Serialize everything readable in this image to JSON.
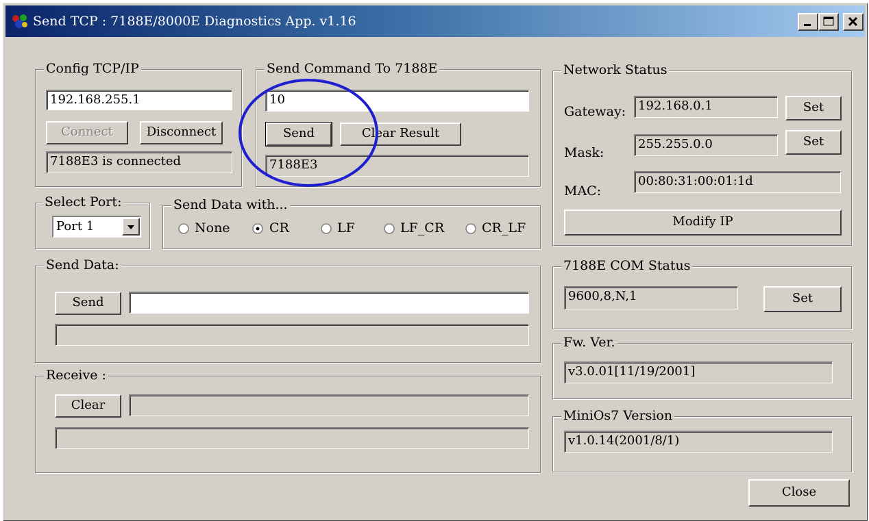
{
  "window": {
    "title": "Send TCP : 7188E/8000E Diagnostics App. v1.16",
    "icon": "app-icon",
    "controls": [
      "minimize-icon",
      "maximize-icon",
      "close-icon"
    ]
  },
  "config": {
    "label": "Config TCP/IP",
    "ip_value": "192.168.255.1",
    "connect_label": "Connect",
    "disconnect_label": "Disconnect",
    "status": "7188E3 is connected"
  },
  "send_command": {
    "label": "Send Command To 7188E",
    "command_value": "10",
    "send_label": "Send",
    "clear_label": "Clear Result",
    "result": "7188E3",
    "highlight_color": "#1f1fd0"
  },
  "port": {
    "label": "Select Port:",
    "selected": "Port 1"
  },
  "send_with": {
    "label": "Send Data with...",
    "options": [
      "None",
      "CR",
      "LF",
      "LF_CR",
      "CR_LF"
    ],
    "selected": "CR"
  },
  "send_data": {
    "label": "Send Data:",
    "send_label": "Send",
    "value": "",
    "status": ""
  },
  "receive": {
    "label": "Receive :",
    "clear_label": "Clear",
    "value": "",
    "data": ""
  },
  "network": {
    "label": "Network Status",
    "gateway_label": "Gateway:",
    "gateway_value": "192.168.0.1",
    "mask_label": "Mask:",
    "mask_value": "255.255.0.0",
    "mac_label": "MAC:",
    "mac_value": "00:80:31:00:01:1d",
    "set_label": "Set",
    "modify_label": "Modify IP"
  },
  "com_status": {
    "label": "7188E COM Status",
    "value": "9600,8,N,1",
    "set_label": "Set"
  },
  "fw": {
    "label": "Fw. Ver.",
    "value": "v3.0.01[11/19/2001]"
  },
  "minios": {
    "label": "MiniOs7 Version",
    "value": "v1.0.14(2001/8/1)"
  },
  "close_label": "Close"
}
